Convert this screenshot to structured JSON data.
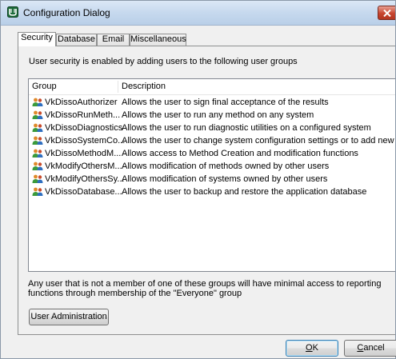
{
  "window": {
    "title": "Configuration Dialog"
  },
  "tabs": [
    {
      "label": "Security",
      "active": true
    },
    {
      "label": "Database"
    },
    {
      "label": "Email"
    },
    {
      "label": "Miscellaneous"
    }
  ],
  "security": {
    "intro": "User security is enabled by adding users to the following user groups",
    "columns": {
      "group": "Group",
      "description": "Description"
    },
    "rows": [
      {
        "group": "VkDissoAuthorizer",
        "description": "Allows the user to sign final acceptance of the results"
      },
      {
        "group": "VkDissoRunMeth...",
        "description": "Allows the user to run any method on any system"
      },
      {
        "group": "VkDissoDiagnostics",
        "description": "Allows the user to run diagnostic utilities on a configured system"
      },
      {
        "group": "VkDissoSystemCo...",
        "description": "Allows the user to change system configuration settings or to add new s..."
      },
      {
        "group": "VkDissoMethodM...",
        "description": "Allows access to Method Creation and modification functions"
      },
      {
        "group": "VkModifyOthersM...",
        "description": "Allows modification of methods owned by other users"
      },
      {
        "group": "VkModifyOthersSy...",
        "description": "Allows modification of systems owned by other users"
      },
      {
        "group": "VkDissoDatabase...",
        "description": "Allows the user to backup and restore the application database"
      }
    ],
    "row_icon": "user-group-icon",
    "footer": "Any user that is not a member of one of these groups will have minimal access to reporting functions through membership of the \"Everyone\" group",
    "user_admin_button": "User Administration"
  },
  "buttons": {
    "ok": {
      "label": "OK",
      "mnemonic": "O",
      "rest": "K"
    },
    "cancel": {
      "label": "Cancel",
      "mnemonic": "C",
      "rest": "ancel"
    }
  },
  "colors": {
    "titlebar": "#c6d9ee",
    "close": "#c7452f",
    "user_icon_green": "#3b9a3b",
    "user_icon_orange": "#e08a2a"
  }
}
